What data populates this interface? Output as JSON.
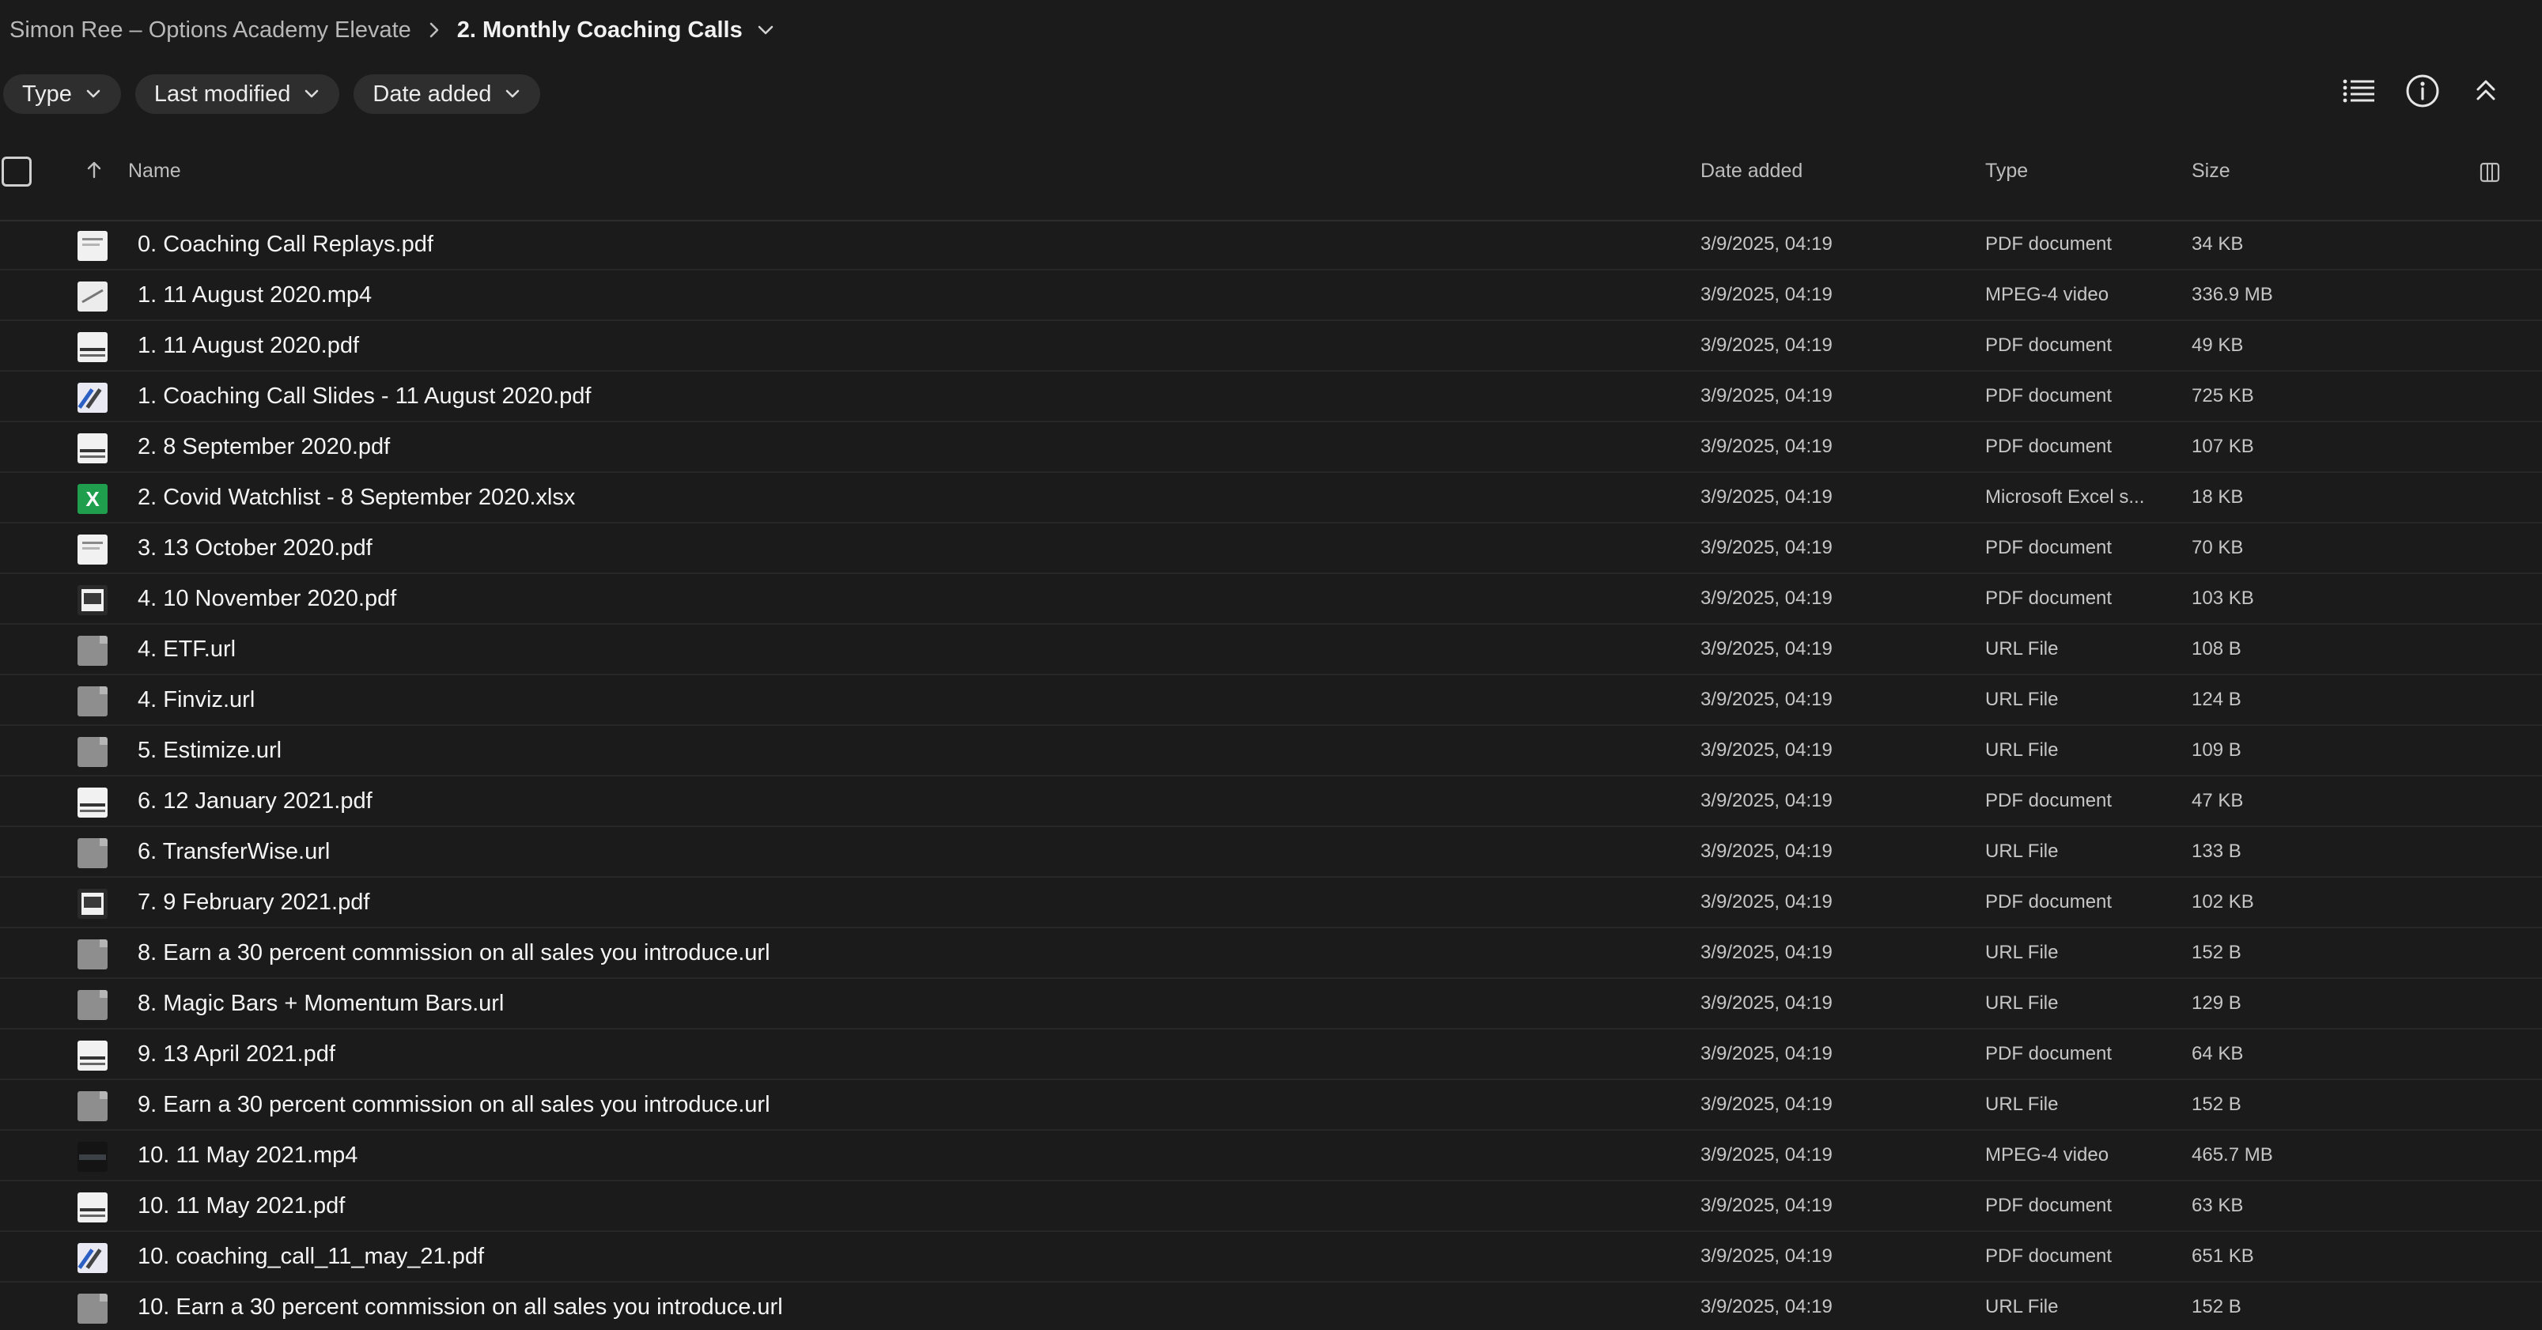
{
  "breadcrumb": {
    "parent": "Simon Ree – Options Academy Elevate",
    "current": "2. Monthly Coaching Calls"
  },
  "filters": {
    "type": "Type",
    "last_modified": "Last modified",
    "date_added": "Date added"
  },
  "columns": {
    "name": "Name",
    "date_added": "Date added",
    "type": "Type",
    "size": "Size"
  },
  "files": [
    {
      "name": "0. Coaching Call Replays.pdf",
      "date": "3/9/2025, 04:19",
      "type": "PDF document",
      "size": "34 KB",
      "icon": "pdf"
    },
    {
      "name": "1. 11 August 2020.mp4",
      "date": "3/9/2025, 04:19",
      "type": "MPEG-4 video",
      "size": "336.9 MB",
      "icon": "video"
    },
    {
      "name": "1. 11 August 2020.pdf",
      "date": "3/9/2025, 04:19",
      "type": "PDF document",
      "size": "49 KB",
      "icon": "pdf2"
    },
    {
      "name": "1. Coaching Call Slides - 11 August 2020.pdf",
      "date": "3/9/2025, 04:19",
      "type": "PDF document",
      "size": "725 KB",
      "icon": "slides"
    },
    {
      "name": "2. 8 September 2020.pdf",
      "date": "3/9/2025, 04:19",
      "type": "PDF document",
      "size": "107 KB",
      "icon": "pdf2"
    },
    {
      "name": "2. Covid Watchlist - 8 September 2020.xlsx",
      "date": "3/9/2025, 04:19",
      "type": "Microsoft Excel s...",
      "size": "18 KB",
      "icon": "excel"
    },
    {
      "name": "3. 13 October 2020.pdf",
      "date": "3/9/2025, 04:19",
      "type": "PDF document",
      "size": "70 KB",
      "icon": "pdf"
    },
    {
      "name": "4. 10 November 2020.pdf",
      "date": "3/9/2025, 04:19",
      "type": "PDF document",
      "size": "103 KB",
      "icon": "pdf3"
    },
    {
      "name": "4. ETF.url",
      "date": "3/9/2025, 04:19",
      "type": "URL File",
      "size": "108 B",
      "icon": "url"
    },
    {
      "name": "4. Finviz.url",
      "date": "3/9/2025, 04:19",
      "type": "URL File",
      "size": "124 B",
      "icon": "url"
    },
    {
      "name": "5. Estimize.url",
      "date": "3/9/2025, 04:19",
      "type": "URL File",
      "size": "109 B",
      "icon": "url"
    },
    {
      "name": "6. 12 January 2021.pdf",
      "date": "3/9/2025, 04:19",
      "type": "PDF document",
      "size": "47 KB",
      "icon": "pdf2"
    },
    {
      "name": "6. TransferWise.url",
      "date": "3/9/2025, 04:19",
      "type": "URL File",
      "size": "133 B",
      "icon": "url"
    },
    {
      "name": "7. 9 February 2021.pdf",
      "date": "3/9/2025, 04:19",
      "type": "PDF document",
      "size": "102 KB",
      "icon": "pdf3"
    },
    {
      "name": "8. Earn a 30 percent commission on all sales you introduce.url",
      "date": "3/9/2025, 04:19",
      "type": "URL File",
      "size": "152 B",
      "icon": "url"
    },
    {
      "name": "8. Magic Bars + Momentum Bars.url",
      "date": "3/9/2025, 04:19",
      "type": "URL File",
      "size": "129 B",
      "icon": "url"
    },
    {
      "name": "9. 13 April 2021.pdf",
      "date": "3/9/2025, 04:19",
      "type": "PDF document",
      "size": "64 KB",
      "icon": "pdf2"
    },
    {
      "name": "9. Earn a 30 percent commission on all sales you introduce.url",
      "date": "3/9/2025, 04:19",
      "type": "URL File",
      "size": "152 B",
      "icon": "url"
    },
    {
      "name": "10. 11 May 2021.mp4",
      "date": "3/9/2025, 04:19",
      "type": "MPEG-4 video",
      "size": "465.7 MB",
      "icon": "video-dark"
    },
    {
      "name": "10. 11 May 2021.pdf",
      "date": "3/9/2025, 04:19",
      "type": "PDF document",
      "size": "63 KB",
      "icon": "pdf2"
    },
    {
      "name": "10. coaching_call_11_may_21.pdf",
      "date": "3/9/2025, 04:19",
      "type": "PDF document",
      "size": "651 KB",
      "icon": "slides"
    },
    {
      "name": "10. Earn a 30 percent commission on all sales you introduce.url",
      "date": "3/9/2025, 04:19",
      "type": "URL File",
      "size": "152 B",
      "icon": "url"
    }
  ]
}
